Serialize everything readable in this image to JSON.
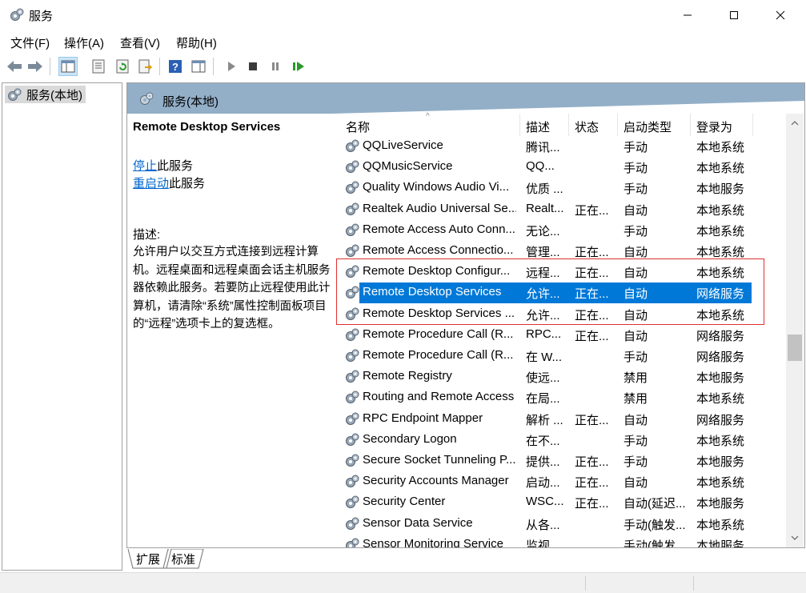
{
  "window": {
    "title": "服务"
  },
  "menu": [
    "文件(F)",
    "操作(A)",
    "查看(V)",
    "帮助(H)"
  ],
  "toolbar": {
    "buttons": [
      "back-icon",
      "forward-icon",
      "show-hide-tree-icon",
      "properties-icon",
      "refresh-icon",
      "export-list-icon",
      "help-icon",
      "show-pane-icon",
      "start-service-icon",
      "stop-service-icon",
      "pause-service-icon",
      "resume-service-icon"
    ]
  },
  "tree": {
    "root_label": "服务(本地)"
  },
  "right_pane": {
    "header_title": "服务(本地)",
    "service_title": "Remote Desktop Services",
    "stop_link": "停止",
    "stop_suffix": "此服务",
    "restart_link": "重启动",
    "restart_suffix": "此服务",
    "desc_label": "描述:",
    "description": "允许用户以交互方式连接到远程计算机。远程桌面和远程桌面会话主机服务器依赖此服务。若要防止远程使用此计算机，请清除“系统”属性控制面板项目的“远程”选项卡上的复选框。"
  },
  "list": {
    "columns": {
      "name": "名称",
      "desc": "描述",
      "status": "状态",
      "startup": "启动类型",
      "logon": "登录为"
    },
    "rows": [
      {
        "name": "QQLiveService",
        "desc": "腾讯...",
        "status": "",
        "startup": "手动",
        "logon": "本地系统"
      },
      {
        "name": "QQMusicService",
        "desc": "QQ...",
        "status": "",
        "startup": "手动",
        "logon": "本地系统"
      },
      {
        "name": "Quality Windows Audio Vi...",
        "desc": "优质 ...",
        "status": "",
        "startup": "手动",
        "logon": "本地服务"
      },
      {
        "name": "Realtek Audio Universal Se...",
        "desc": "Realt...",
        "status": "正在...",
        "startup": "自动",
        "logon": "本地系统"
      },
      {
        "name": "Remote Access Auto Conn...",
        "desc": "无论...",
        "status": "",
        "startup": "手动",
        "logon": "本地系统"
      },
      {
        "name": "Remote Access Connectio...",
        "desc": "管理...",
        "status": "正在...",
        "startup": "自动",
        "logon": "本地系统"
      },
      {
        "name": "Remote Desktop Configur...",
        "desc": "远程...",
        "status": "正在...",
        "startup": "自动",
        "logon": "本地系统"
      },
      {
        "name": "Remote Desktop Services",
        "desc": "允许...",
        "status": "正在...",
        "startup": "自动",
        "logon": "网络服务",
        "selected": true
      },
      {
        "name": "Remote Desktop Services ...",
        "desc": "允许...",
        "status": "正在...",
        "startup": "自动",
        "logon": "本地系统"
      },
      {
        "name": "Remote Procedure Call (R...",
        "desc": "RPC...",
        "status": "正在...",
        "startup": "自动",
        "logon": "网络服务"
      },
      {
        "name": "Remote Procedure Call (R...",
        "desc": "在 W...",
        "status": "",
        "startup": "手动",
        "logon": "网络服务"
      },
      {
        "name": "Remote Registry",
        "desc": "使远...",
        "status": "",
        "startup": "禁用",
        "logon": "本地服务"
      },
      {
        "name": "Routing and Remote Access",
        "desc": "在局...",
        "status": "",
        "startup": "禁用",
        "logon": "本地系统"
      },
      {
        "name": "RPC Endpoint Mapper",
        "desc": "解析 ...",
        "status": "正在...",
        "startup": "自动",
        "logon": "网络服务"
      },
      {
        "name": "Secondary Logon",
        "desc": "在不...",
        "status": "",
        "startup": "手动",
        "logon": "本地系统"
      },
      {
        "name": "Secure Socket Tunneling P...",
        "desc": "提供...",
        "status": "正在...",
        "startup": "手动",
        "logon": "本地服务"
      },
      {
        "name": "Security Accounts Manager",
        "desc": "启动...",
        "status": "正在...",
        "startup": "自动",
        "logon": "本地系统"
      },
      {
        "name": "Security Center",
        "desc": "WSC...",
        "status": "正在...",
        "startup": "自动(延迟...",
        "logon": "本地服务"
      },
      {
        "name": "Sensor Data Service",
        "desc": "从各...",
        "status": "",
        "startup": "手动(触发...",
        "logon": "本地系统"
      },
      {
        "name": "Sensor Monitoring Service",
        "desc": "监视...",
        "status": "",
        "startup": "手动(触发...",
        "logon": "本地服务"
      }
    ]
  },
  "tabs": [
    "扩展",
    "标准"
  ],
  "colors": {
    "selection": "#0078d7",
    "header_band": "#93afc8",
    "highlight_box": "#e03030",
    "link": "#0066cc"
  }
}
